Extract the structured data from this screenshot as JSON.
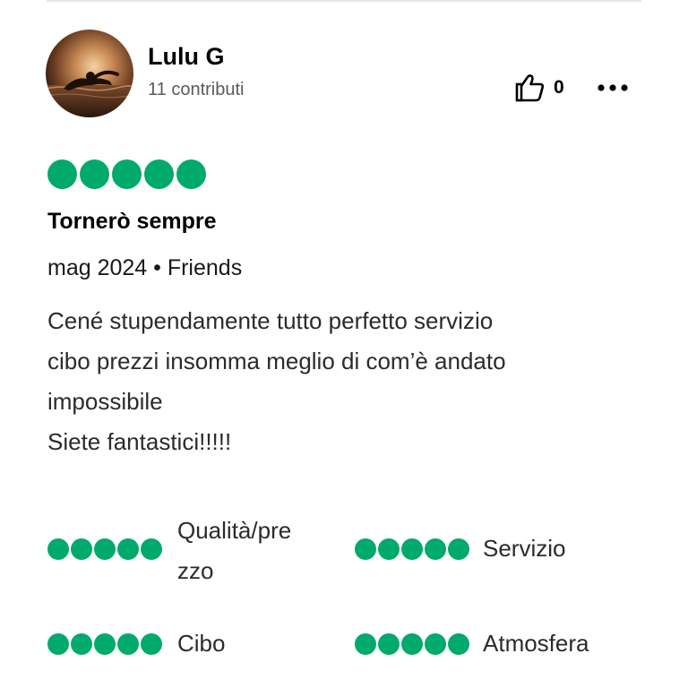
{
  "review": {
    "user": {
      "name": "Lulu G",
      "contributions": "11 contributi"
    },
    "helpful": {
      "icon": "thumbs-up-icon",
      "count": "0"
    },
    "more_icon": "more-options-icon",
    "rating": {
      "value": 5,
      "max": 5
    },
    "title": "Tornerò sempre",
    "meta": "mag 2024 • Friends",
    "body_lines": [
      "Cené stupendamente tutto perfetto servizio",
      "cibo prezzi insomma meglio di com’è andato",
      "impossibile",
      "Siete fantastici!!!!!"
    ],
    "sub_ratings": [
      {
        "label_lines": [
          "Qualità/pre",
          "zzo"
        ],
        "value": 5,
        "max": 5
      },
      {
        "label": "Servizio",
        "value": 5,
        "max": 5
      },
      {
        "label": "Cibo",
        "value": 5,
        "max": 5
      },
      {
        "label": "Atmosfera",
        "value": 5,
        "max": 5
      }
    ]
  },
  "colors": {
    "rating_green": "#00aa6c",
    "text_primary": "#000000",
    "text_secondary": "#5a5a5a"
  }
}
